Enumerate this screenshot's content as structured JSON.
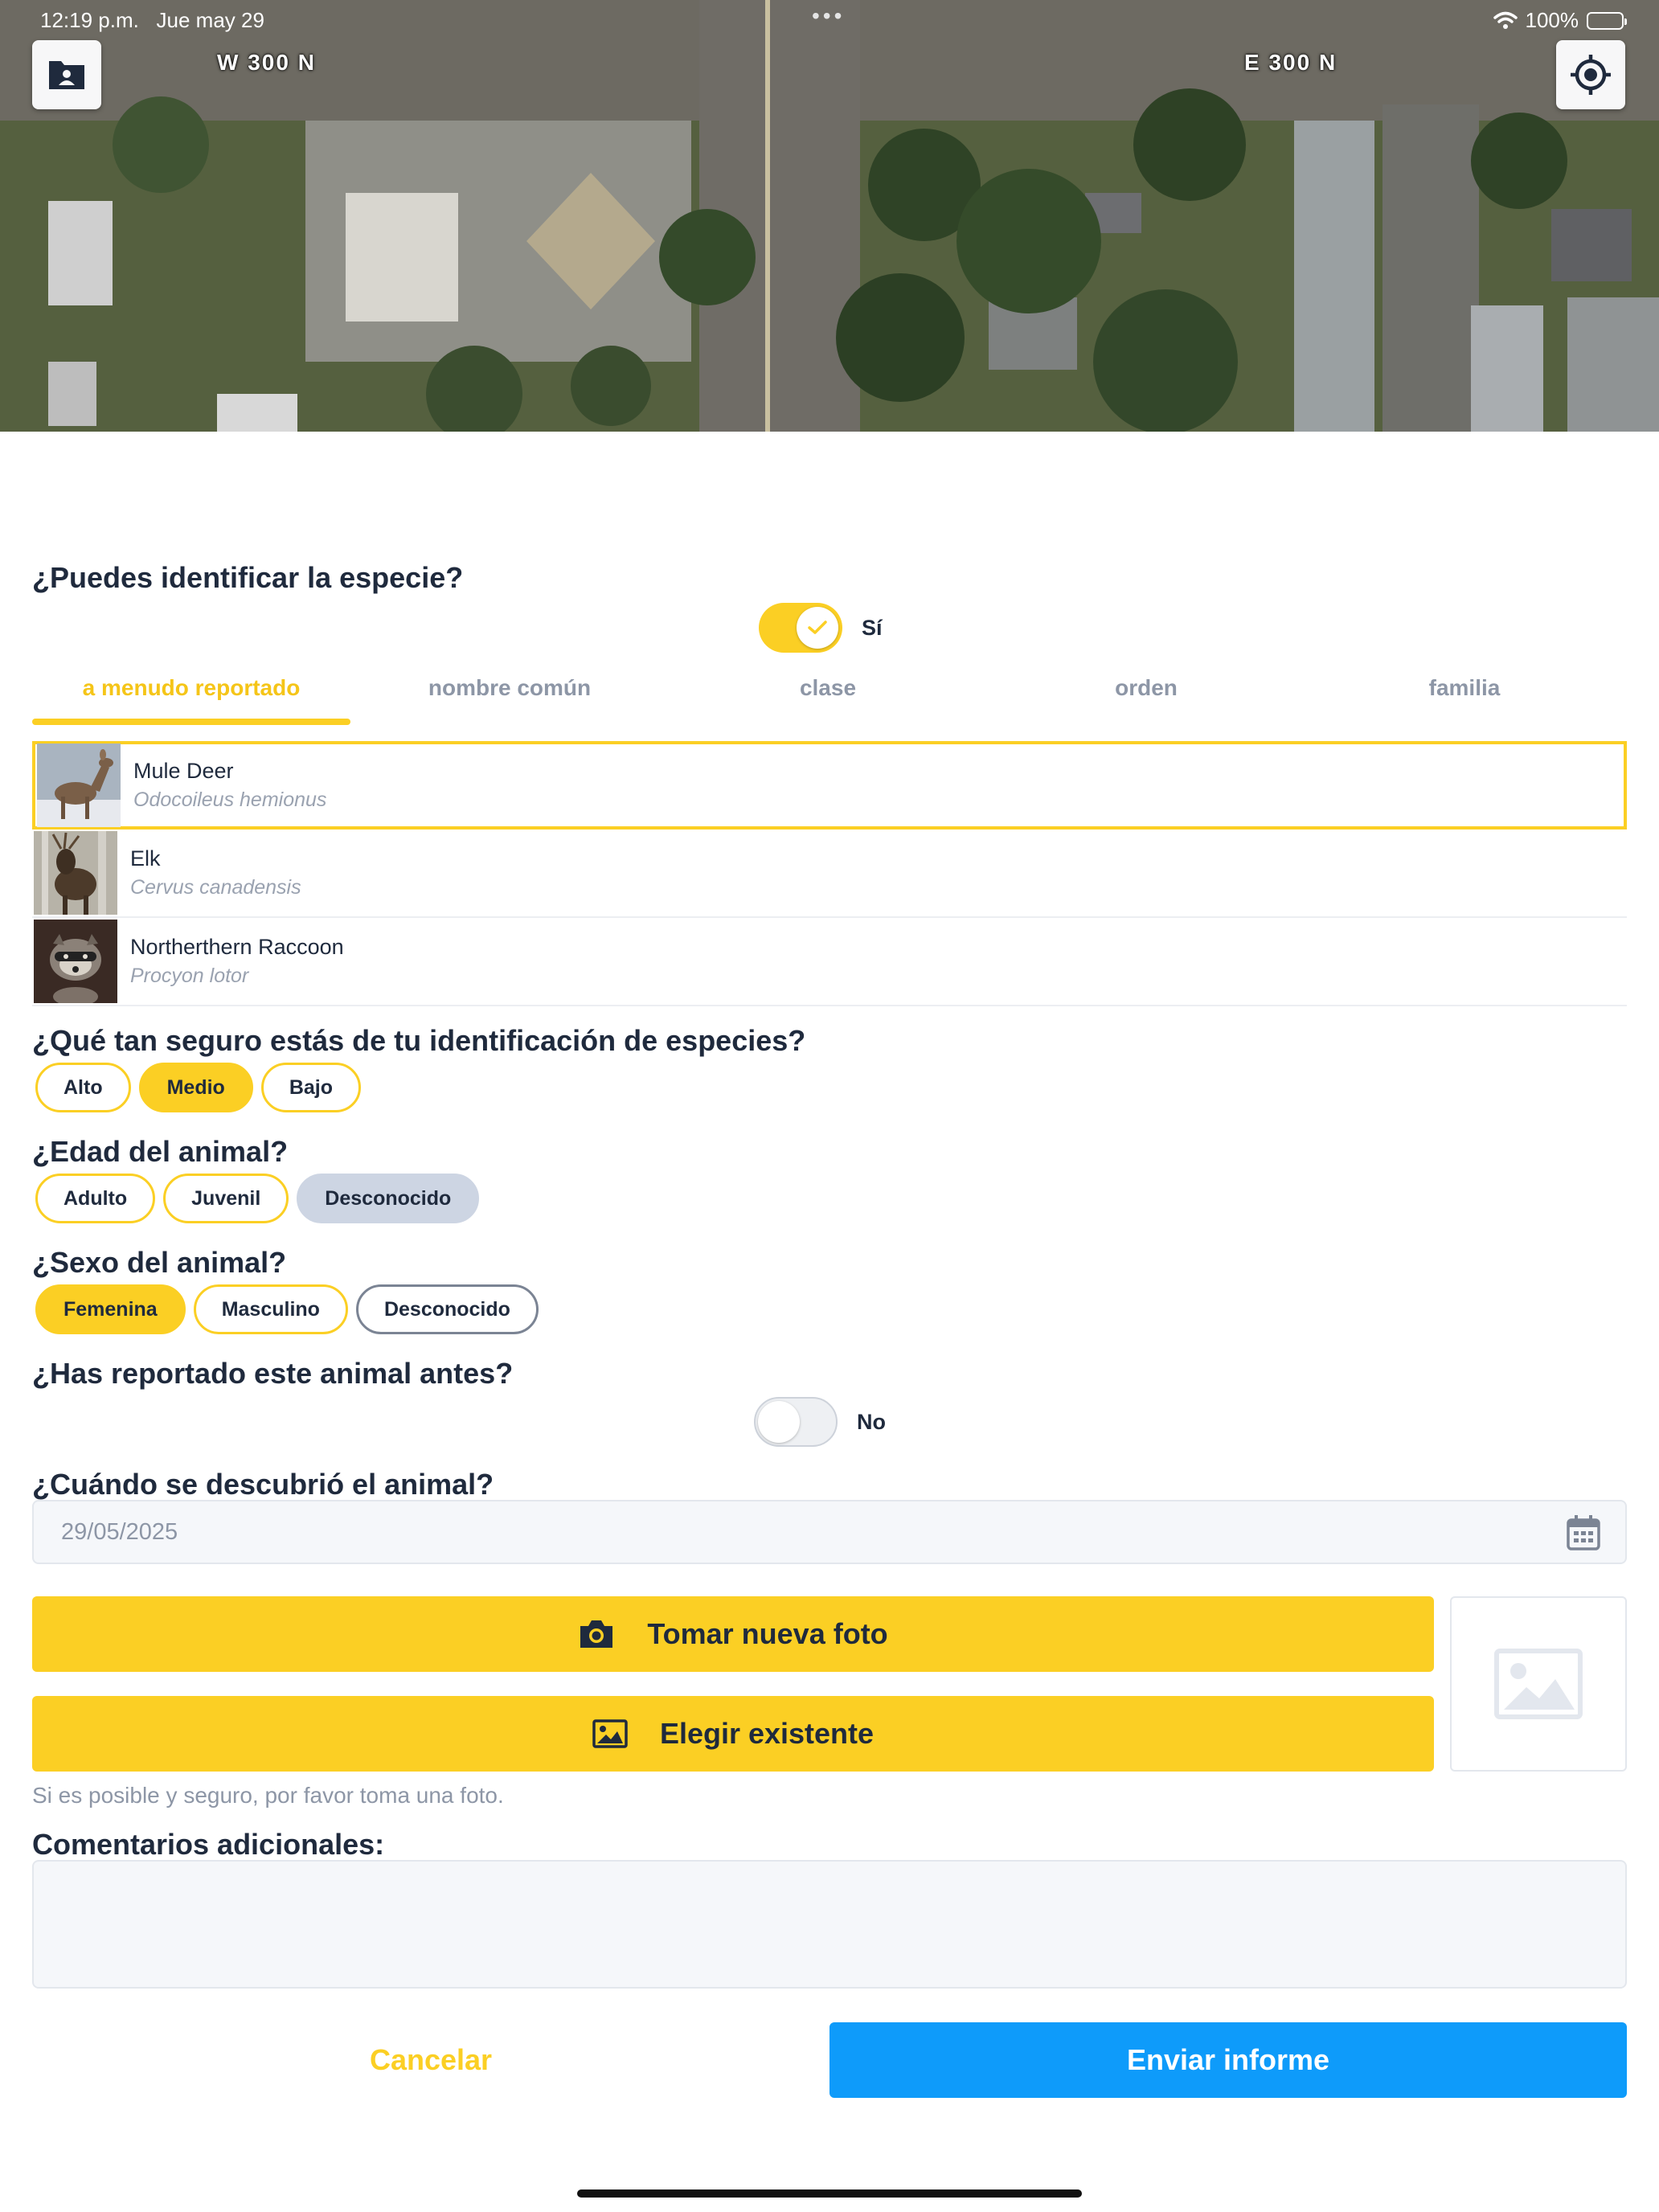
{
  "status_bar": {
    "time": "12:19 p.m.",
    "date": "Jue may 29",
    "dots": "•••",
    "battery": "100%"
  },
  "map": {
    "streets": [
      "W 300 N",
      "E 300 N"
    ],
    "left_button_icon": "contact-folder-icon",
    "right_button_icon": "locate-crosshair-icon"
  },
  "species_question": {
    "label": "¿Puedes identificar la especie?",
    "toggle_on": true,
    "toggle_label": "Sí"
  },
  "tabs": [
    {
      "label": "a menudo reportado",
      "active": true
    },
    {
      "label": "nombre común",
      "active": false
    },
    {
      "label": "clase",
      "active": false
    },
    {
      "label": "orden",
      "active": false
    },
    {
      "label": "familia",
      "active": false
    }
  ],
  "species": [
    {
      "name": "Mule Deer",
      "scientific": "Odocoileus hemionus",
      "selected": true
    },
    {
      "name": "Elk",
      "scientific": "Cervus canadensis",
      "selected": false
    },
    {
      "name": "Northerthern Raccoon",
      "scientific": "Procyon lotor",
      "selected": false
    }
  ],
  "confidence": {
    "label": "¿Qué tan seguro estás de tu identificación de especies?",
    "options": [
      "Alto",
      "Medio",
      "Bajo"
    ],
    "selected": "Medio"
  },
  "age": {
    "label": "¿Edad del animal?",
    "options": [
      "Adulto",
      "Juvenil",
      "Desconocido"
    ],
    "selected": "Desconocido"
  },
  "sex": {
    "label": "¿Sexo del animal?",
    "options": [
      "Femenina",
      "Masculino",
      "Desconocido"
    ],
    "selected": "Femenina"
  },
  "reported_before": {
    "label": "¿Has reportado este animal antes?",
    "toggle_on": false,
    "toggle_label": "No"
  },
  "discovered": {
    "label": "¿Cuándo se descubrió el animal?",
    "date_value": "29/05/2025",
    "icon": "calendar-icon"
  },
  "photo": {
    "take_label": "Tomar nueva foto",
    "take_icon": "camera-icon",
    "choose_label": "Elegir existente",
    "choose_icon": "image-icon",
    "hint": "Si es posible y seguro, por favor toma una foto.",
    "preview_icon": "image-placeholder-icon"
  },
  "comments": {
    "label": "Comentarios adicionales:",
    "value": ""
  },
  "actions": {
    "cancel_label": "Cancelar",
    "submit_label": "Enviar informe"
  },
  "colors": {
    "accent_yellow": "#fbcf24",
    "submit_blue": "#0e9bfa",
    "text_dark": "#1f2a3d",
    "muted": "#8d96a6"
  }
}
